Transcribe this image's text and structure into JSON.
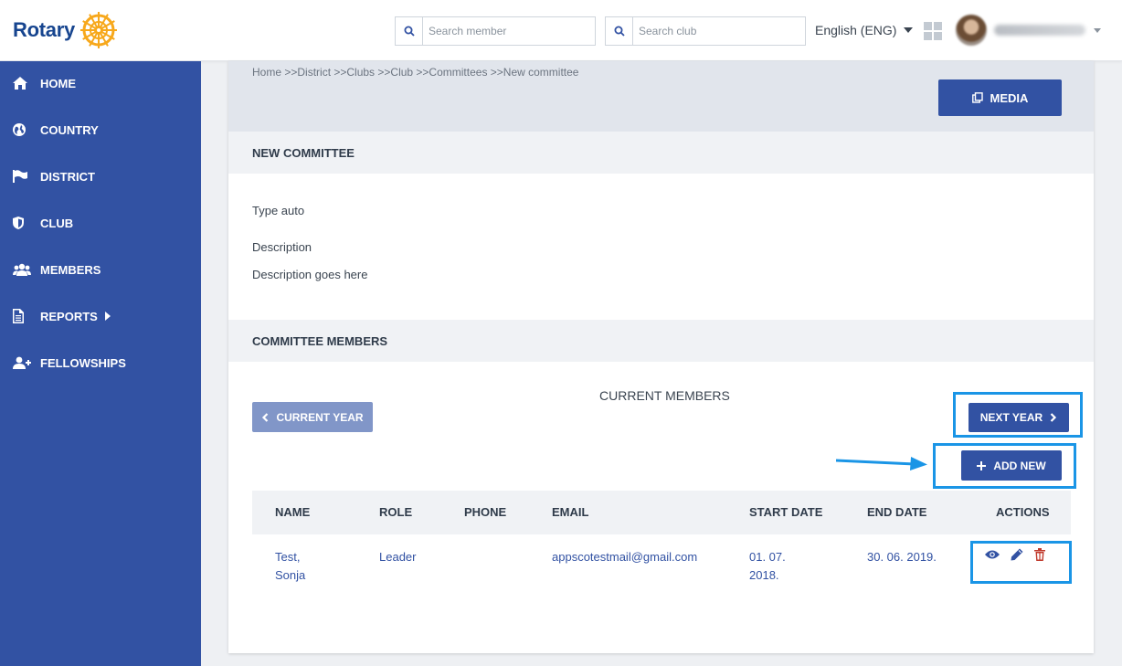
{
  "header": {
    "logo_text": "Rotary",
    "search_member_placeholder": "Search member",
    "search_club_placeholder": "Search club",
    "language": "English (ENG)"
  },
  "sidebar": {
    "items": [
      {
        "label": "HOME",
        "icon": "home-icon"
      },
      {
        "label": "COUNTRY",
        "icon": "globe-icon"
      },
      {
        "label": "DISTRICT",
        "icon": "flag-icon"
      },
      {
        "label": "CLUB",
        "icon": "shield-icon"
      },
      {
        "label": "MEMBERS",
        "icon": "users-icon"
      },
      {
        "label": "REPORTS",
        "icon": "document-icon"
      },
      {
        "label": "FELLOWSHIPS",
        "icon": "user-plus-icon"
      }
    ]
  },
  "breadcrumb": "Home >>District >>Clubs >>Club >>Committees >>New committee",
  "media_label": "MEDIA",
  "committee": {
    "section_title": "NEW COMMITTEE",
    "type": "Type auto",
    "description_label": "Description",
    "description_value": "Description goes here"
  },
  "members": {
    "section_title": "COMMITTEE MEMBERS",
    "current_title": "CURRENT MEMBERS",
    "prev_year_label": "CURRENT YEAR",
    "next_year_label": "NEXT YEAR",
    "add_new_label": "ADD NEW",
    "columns": [
      "NAME",
      "ROLE",
      "PHONE",
      "EMAIL",
      "START DATE",
      "END DATE",
      "ACTIONS"
    ],
    "rows": [
      {
        "name_line1": "Test,",
        "name_line2": "Sonja",
        "role": "Leader",
        "phone": "",
        "email": "appscotestmail@gmail.com",
        "start_line1": "01. 07.",
        "start_line2": "2018.",
        "end": "30. 06. 2019."
      }
    ]
  },
  "colors": {
    "primary": "#3252a3",
    "primary_light": "#8196c8",
    "highlight": "#1a95e6",
    "delete": "#c0392b",
    "logo_gold": "#f7a81b"
  }
}
